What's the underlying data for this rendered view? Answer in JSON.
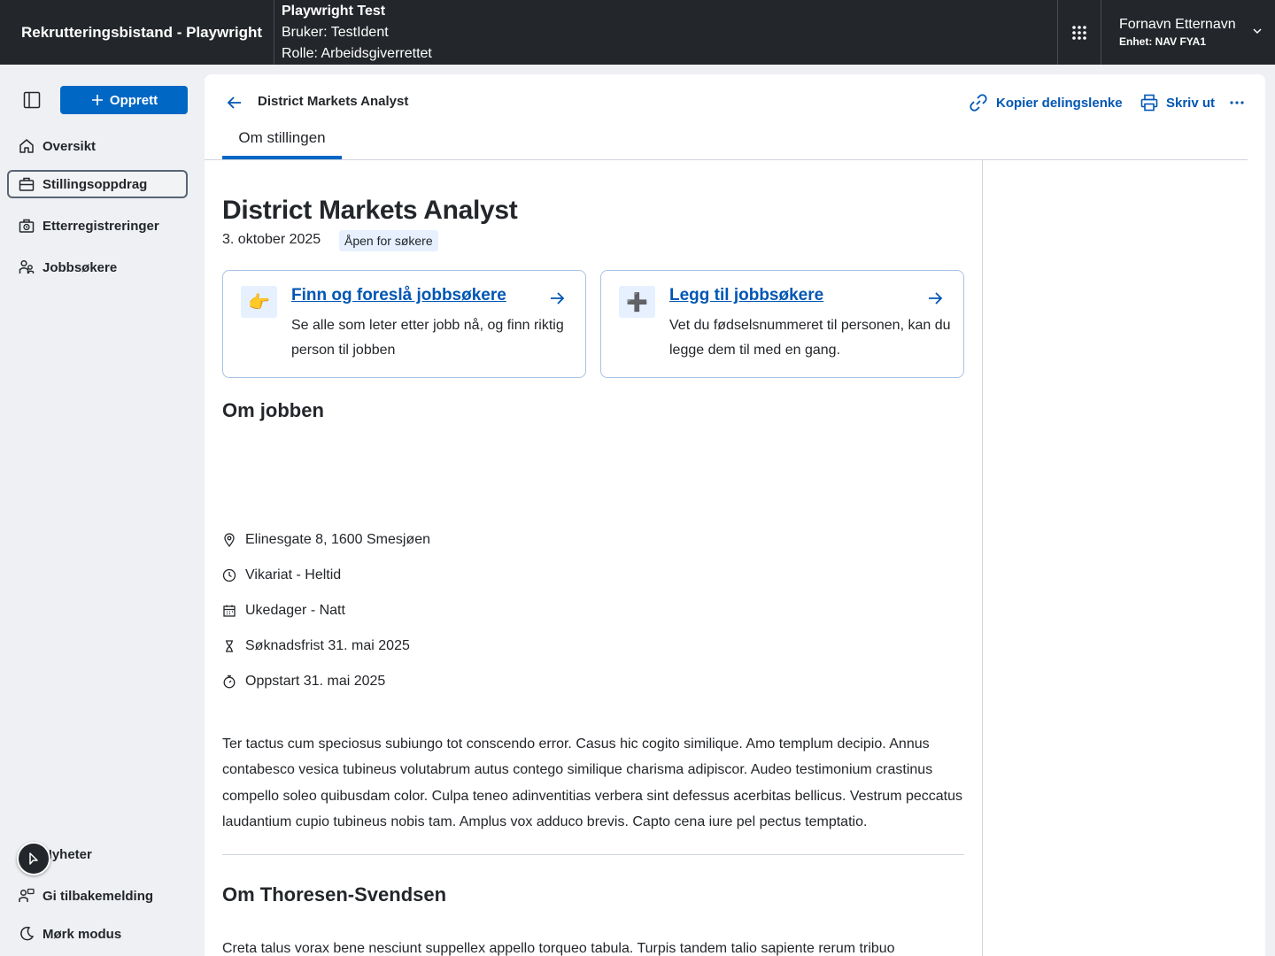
{
  "header": {
    "app_title": "Rekrutteringsbistand - Playwright",
    "env_title": "Playwright Test",
    "user_line": "Bruker: TestIdent",
    "role_line": "Rolle: Arbeidsgiverrettet",
    "user_name": "Fornavn Etternavn",
    "user_unit": "Enhet: NAV FYA1"
  },
  "sidebar": {
    "create_label": "Opprett",
    "items": [
      {
        "label": "Oversikt",
        "icon": "house-icon"
      },
      {
        "label": "Stillingsoppdrag",
        "icon": "briefcase-icon",
        "active": true
      },
      {
        "label": "Etterregistreringer",
        "icon": "briefcase-clock-icon"
      },
      {
        "label": "Jobbsøkere",
        "icon": "people-icon"
      }
    ],
    "bottom_items": [
      {
        "label": "Nyheter",
        "icon": "megaphone-icon"
      },
      {
        "label": "Gi tilbakemelding",
        "icon": "person-chat-icon"
      },
      {
        "label": "Mørk modus",
        "icon": "moon-icon"
      }
    ]
  },
  "page": {
    "crumb_title": "District Markets Analyst",
    "copy_link_label": "Kopier delingslenke",
    "print_label": "Skriv ut",
    "tab_label": "Om stillingen",
    "title": "District Markets Analyst",
    "date": "3. oktober 2025",
    "status": "Åpen for søkere",
    "cards": [
      {
        "emoji": "👉",
        "title": "Finn og foreslå jobbsøkere",
        "desc": "Se alle som leter etter jobb nå, og finn riktig person til jobben"
      },
      {
        "emoji": "➕",
        "title": "Legg til jobbsøkere",
        "desc": "Vet du fødselsnummeret til personen, kan du legge dem til med en gang."
      }
    ],
    "about_job_heading": "Om jobben",
    "facts": [
      {
        "icon": "location-pin-icon",
        "text": "Elinesgate 8, 1600 Smesjøen"
      },
      {
        "icon": "clock-icon",
        "text": "Vikariat - Heltid"
      },
      {
        "icon": "calendar-icon",
        "text": "Ukedager - Natt"
      },
      {
        "icon": "hourglass-icon",
        "text": "Søknadsfrist 31. mai 2025"
      },
      {
        "icon": "stopwatch-icon",
        "text": "Oppstart 31. mai 2025"
      }
    ],
    "description": "Ter tactus cum speciosus subiungo tot conscendo error. Casus hic cogito similique. Amo templum decipio. Annus contabesco vesica tubineus volutabrum autus contego similique charisma adipiscor. Audeo testimonium crastinus compello soleo quibusdam color. Culpa teneo adinventitias verbera sint defessus acerbitas bellicus. Vestrum peccatus laudantium cupio tubineus nobis tam. Amplus vox adduco brevis. Capto cena iure pel pectus temptatio.",
    "employer_heading": "Om Thoresen-Svendsen",
    "employer_text": "Creta talus vorax bene nesciunt suppellex appello torqueo tabula. Turpis tandem talio sapiente rerum tribuo"
  }
}
